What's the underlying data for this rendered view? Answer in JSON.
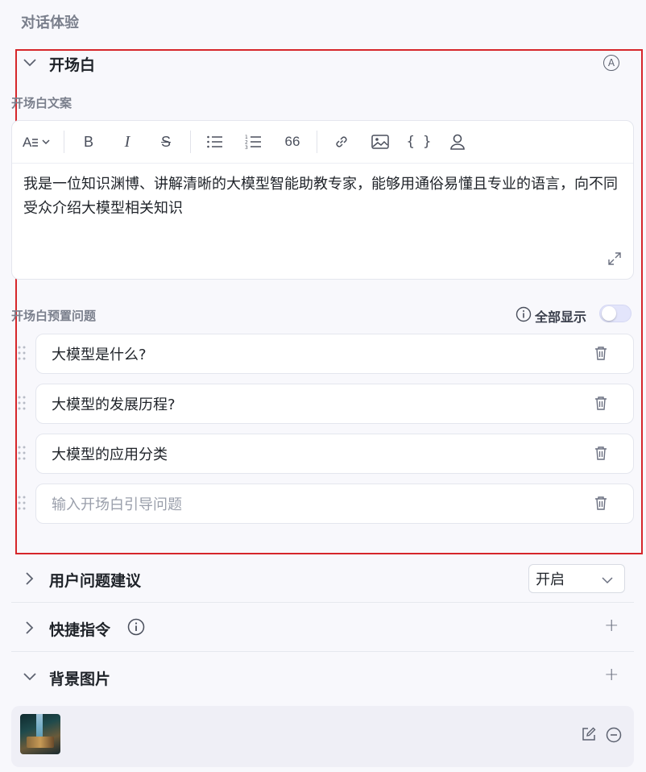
{
  "section": {
    "title": "对话体验"
  },
  "opening": {
    "title": "开场白",
    "auto_badge": "A",
    "text_label": "开场白文案",
    "editor_text": "我是一位知识渊博、讲解清晰的大模型智能助教专家，能够用通俗易懂且专业的语言，向不同受众介绍大模型相关知识",
    "questions_label": "开场白预置问题",
    "show_all_label": "全部显示",
    "show_all_on": false,
    "questions": [
      "大模型是什么?",
      "大模型的发展历程?",
      "大模型的应用分类"
    ],
    "question_placeholder": "输入开场白引导问题"
  },
  "toolbar": {
    "heading_icon": "heading-icon",
    "bold": "B",
    "italic": "I",
    "strike": "S",
    "quote": "66"
  },
  "user_suggestions": {
    "title": "用户问题建议",
    "select_value": "开启"
  },
  "shortcuts": {
    "title": "快捷指令"
  },
  "background": {
    "title": "背景图片"
  },
  "colors": {
    "highlight": "#d6262b",
    "card_bg": "#efeff6",
    "page_bg": "#f8f8fc"
  }
}
